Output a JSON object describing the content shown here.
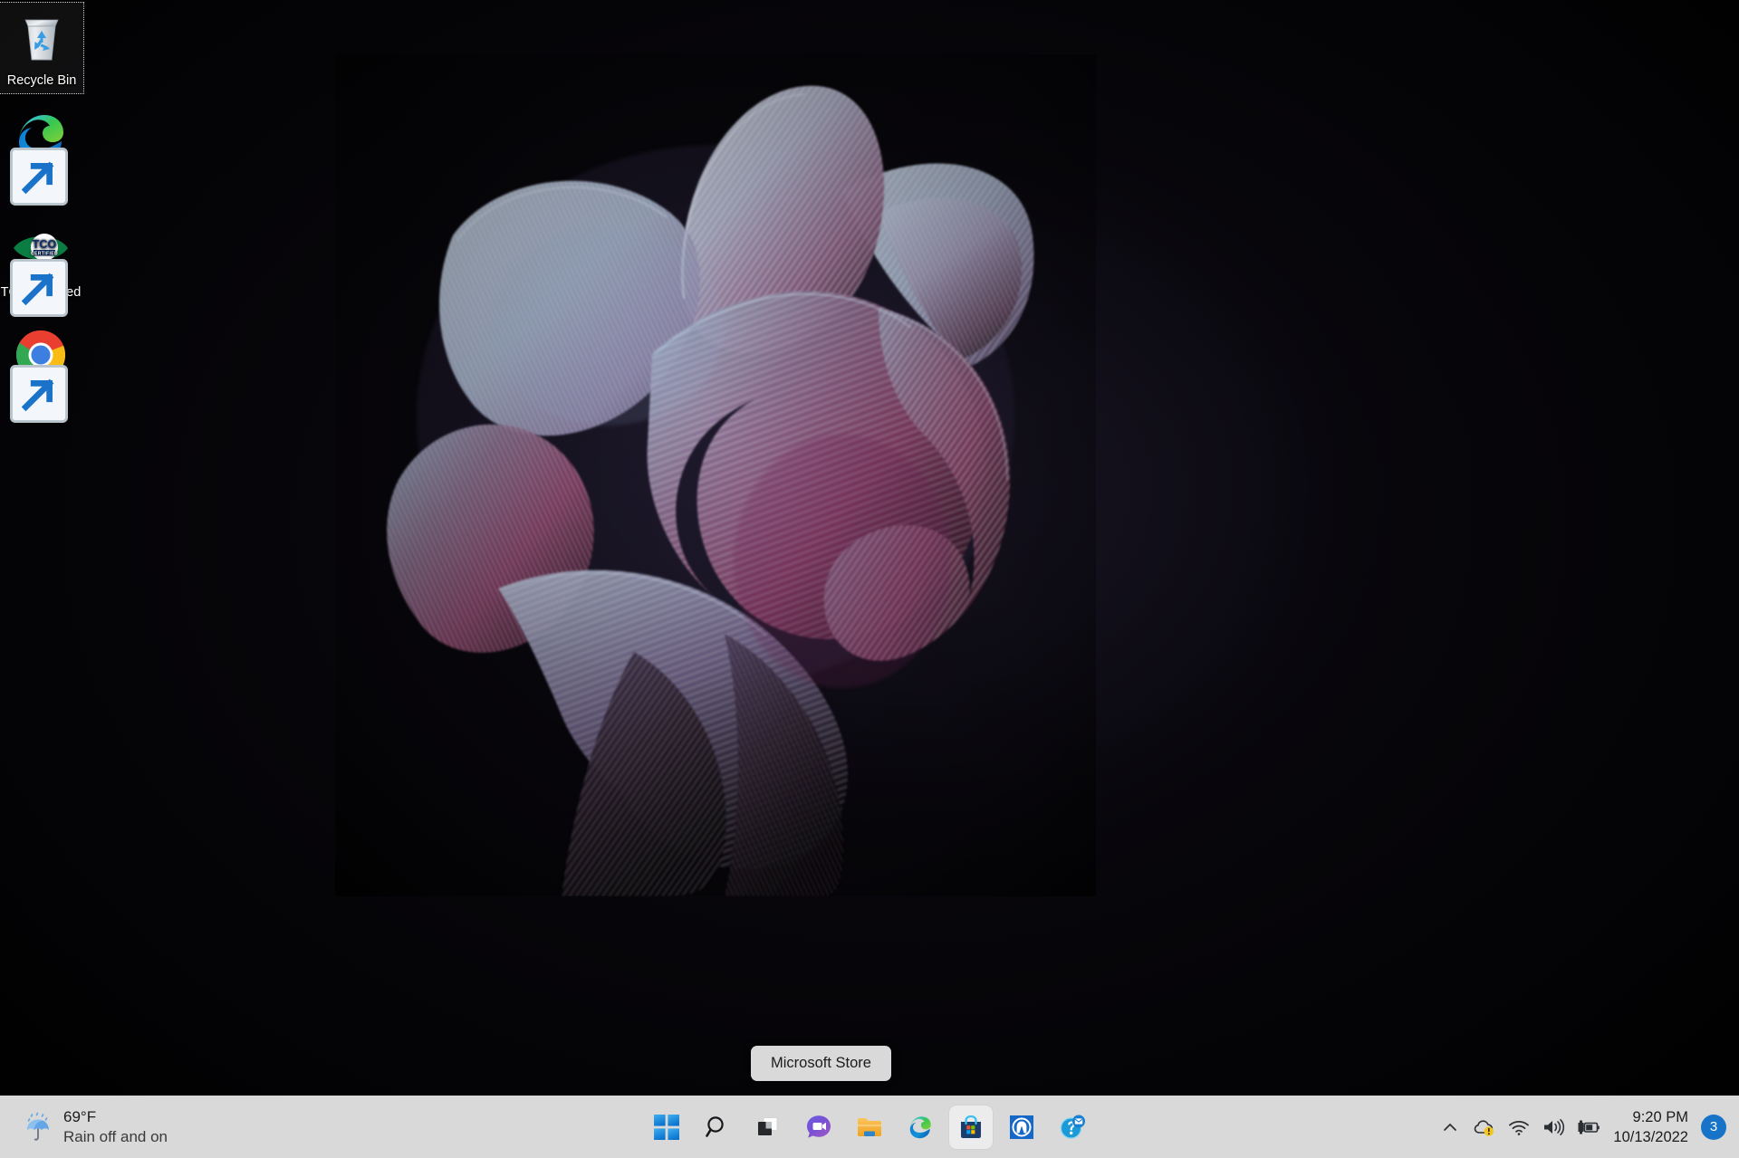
{
  "desktop": {
    "icons": [
      {
        "name": "recycle-bin",
        "label": "Recycle Bin",
        "selected": true,
        "shortcut": false
      },
      {
        "name": "microsoft-edge",
        "label": "Microsoft Edge",
        "selected": false,
        "shortcut": true
      },
      {
        "name": "tco-certified",
        "label": "TCO Certified",
        "selected": false,
        "shortcut": true
      },
      {
        "name": "google-chrome",
        "label": "Google Chrome",
        "selected": false,
        "shortcut": true
      }
    ]
  },
  "tooltip": {
    "text": "Microsoft Store"
  },
  "taskbar": {
    "background_color": "#d9d9d9",
    "weather": {
      "icon": "rain-umbrella-icon",
      "temperature": "69°F",
      "condition": "Rain off and on"
    },
    "buttons": [
      {
        "name": "start-button",
        "label": "Start",
        "icon": "windows-logo-icon",
        "active": false
      },
      {
        "name": "search-button",
        "label": "Search",
        "icon": "search-icon",
        "active": false
      },
      {
        "name": "task-view-button",
        "label": "Task View",
        "icon": "task-view-icon",
        "active": false
      },
      {
        "name": "chat-button",
        "label": "Chat",
        "icon": "chat-video-icon",
        "active": false
      },
      {
        "name": "file-explorer-button",
        "label": "File Explorer",
        "icon": "folder-icon",
        "active": false
      },
      {
        "name": "edge-button",
        "label": "Microsoft Edge",
        "icon": "edge-icon",
        "active": false
      },
      {
        "name": "store-button",
        "label": "Microsoft Store",
        "icon": "store-bag-icon",
        "active": true
      },
      {
        "name": "home-app-button",
        "label": "Home",
        "icon": "home-arch-icon",
        "active": false
      },
      {
        "name": "help-button",
        "label": "Get Help",
        "icon": "help-mail-icon",
        "active": false
      }
    ],
    "tray": [
      {
        "name": "show-hidden-icons",
        "label": "Show hidden icons",
        "icon": "chevron-up-icon"
      },
      {
        "name": "onedrive-status",
        "label": "OneDrive",
        "icon": "cloud-warning-icon"
      },
      {
        "name": "network-status",
        "label": "Network",
        "icon": "wifi-icon"
      },
      {
        "name": "volume-status",
        "label": "Volume",
        "icon": "speaker-icon"
      },
      {
        "name": "battery-status",
        "label": "Battery charging",
        "icon": "battery-charging-icon"
      }
    ],
    "clock": {
      "time": "9:20 PM",
      "date": "10/13/2022"
    },
    "notifications": {
      "count": "3",
      "badge_color": "#1673c8"
    }
  }
}
